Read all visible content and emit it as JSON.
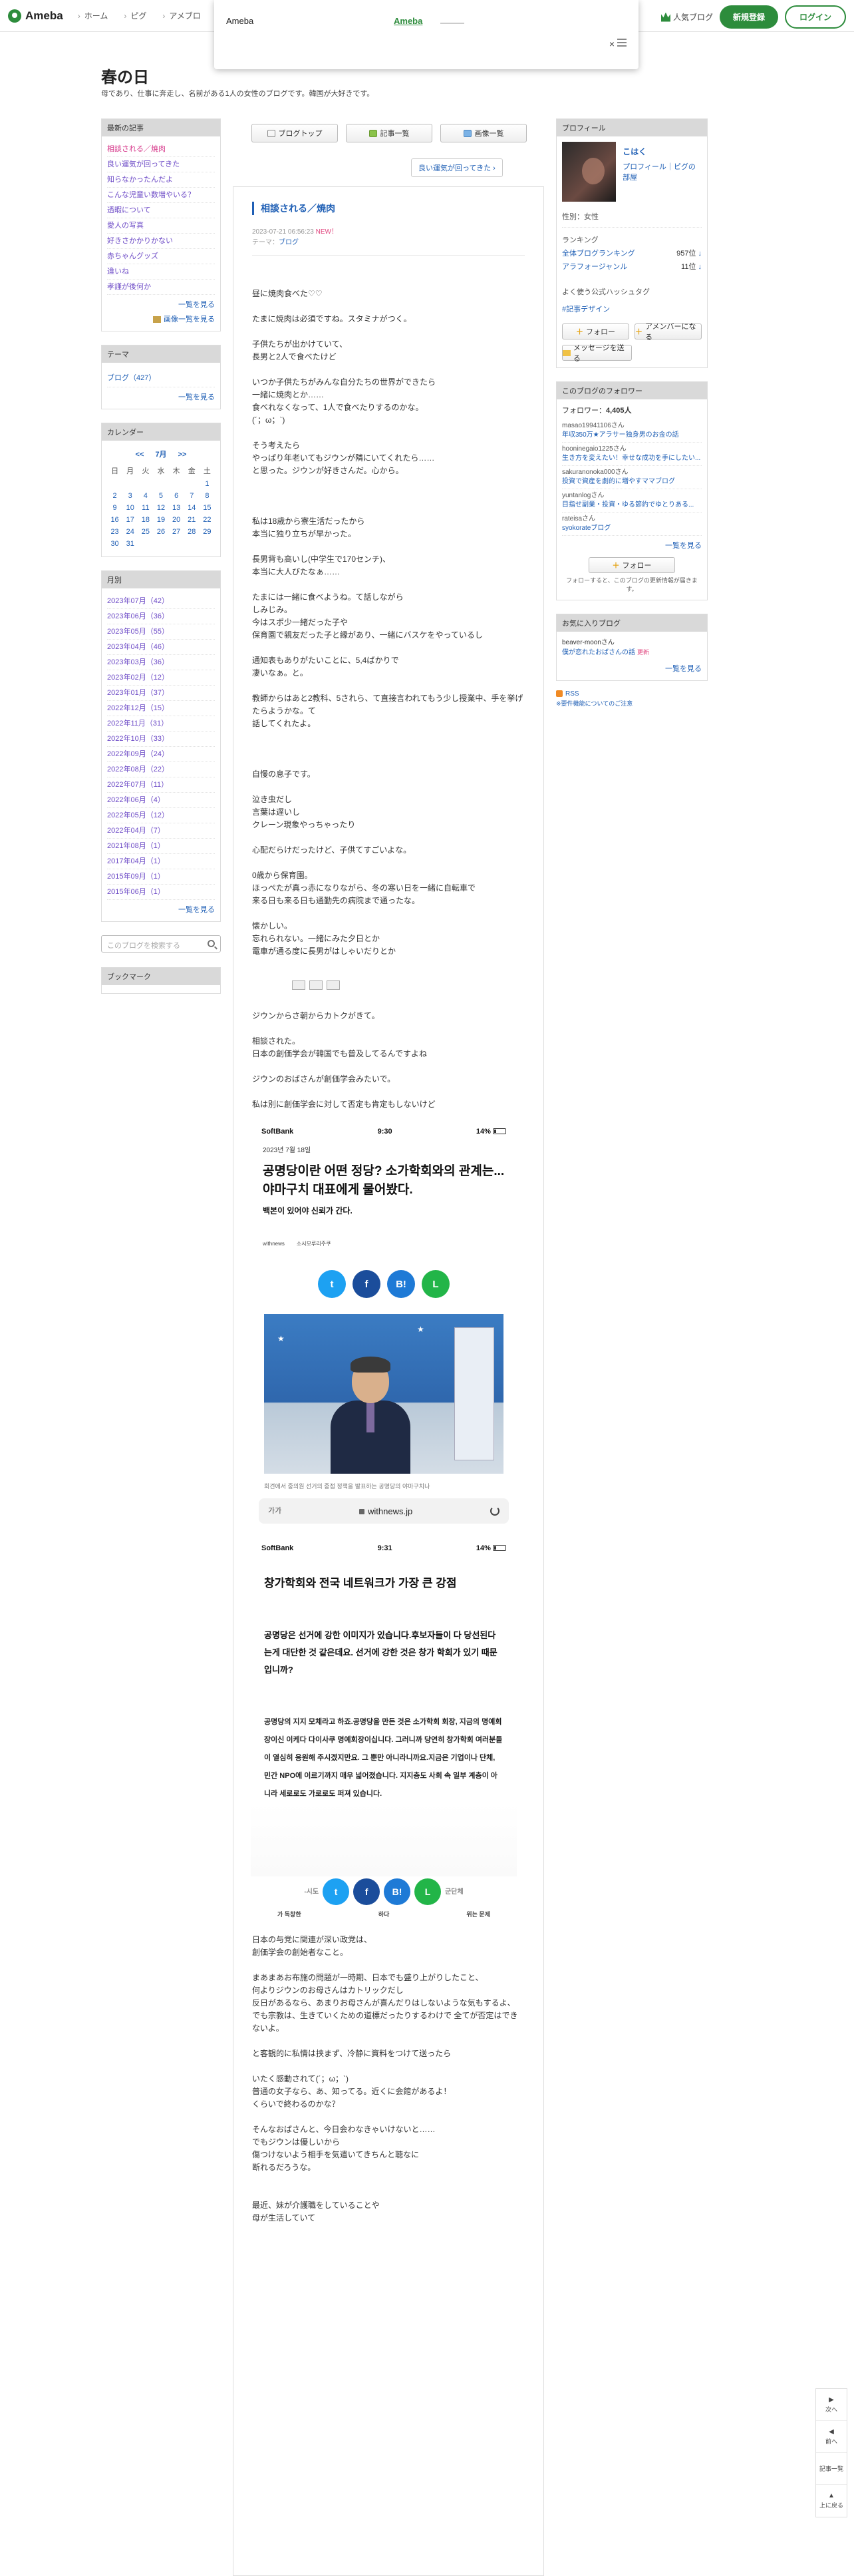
{
  "global_header": {
    "logo": "Ameba",
    "nav": [
      "ホーム",
      "ピグ",
      "アメブロ"
    ],
    "popular_blog": "人気ブログ",
    "register": "新規登録",
    "login": "ログイン"
  },
  "popup": {
    "title": "Ameba",
    "link": "Ameba",
    "close": "×"
  },
  "blog": {
    "title": "春の日",
    "description": "母であり、仕事に奔走し、名前がある1人の女性のブログです。韓国が大好きです。"
  },
  "sidebar_left": {
    "recent_header": "最新の記事",
    "recent": [
      "相談される／焼肉",
      "良い運気が回ってきた",
      "知らなかったんだよ",
      "こんな児童い数増やいる？",
      "透暇について",
      "愛人の写真",
      "好きさかかりかない",
      "赤ちゃんグッズ",
      "違いね",
      "孝謹が後何か"
    ],
    "recent_more": "一覧を見る",
    "recent_photo_more": "画像一覧を見る",
    "theme_header": "テーマ",
    "themes": [
      "ブログ（427）"
    ],
    "theme_more": "一覧を見る",
    "calendar_header": "カレンダー",
    "calendar": {
      "prev": "<<",
      "month": "7月",
      "next": ">>",
      "weekdays": [
        "日",
        "月",
        "火",
        "水",
        "木",
        "金",
        "土"
      ],
      "weeks": [
        [
          "",
          "",
          "",
          "",
          "",
          "",
          "1"
        ],
        [
          "2",
          "3",
          "4",
          "5",
          "6",
          "7",
          "8"
        ],
        [
          "9",
          "10",
          "11",
          "12",
          "13",
          "14",
          "15"
        ],
        [
          "16",
          "17",
          "18",
          "19",
          "20",
          "21",
          "22"
        ],
        [
          "23",
          "24",
          "25",
          "26",
          "27",
          "28",
          "29"
        ],
        [
          "30",
          "31",
          "",
          "",
          "",
          "",
          ""
        ]
      ]
    },
    "monthly_header": "月別",
    "months": [
      "2023年07月（42）",
      "2023年06月（36）",
      "2023年05月（55）",
      "2023年04月（46）",
      "2023年03月（36）",
      "2023年02月（12）",
      "2023年01月（37）",
      "2022年12月（15）",
      "2022年11月（31）",
      "2022年10月（33）",
      "2022年09月（24）",
      "2022年08月（22）",
      "2022年07月（11）",
      "2022年06月（4）",
      "2022年05月（12）",
      "2022年04月（7）",
      "2021年08月（1）",
      "2017年04月（1）",
      "2015年09月（1）",
      "2015年06月（1）"
    ],
    "months_more": "一覧を見る",
    "search_placeholder": "このブログを検索する",
    "bookmark_header": "ブックマーク"
  },
  "center": {
    "tabs": [
      "ブログトップ",
      "記事一覧",
      "画像一覧"
    ],
    "older_link": "良い運気が回ってきた",
    "article": {
      "title": "相談される／焼肉",
      "date": "2023-07-21 06:56:23",
      "new_badge": "NEW！",
      "theme_label": "テーマ：",
      "theme": "ブログ",
      "body_a": [
        "昼に焼肉食べた♡♡",
        "",
        "たまに焼肉は必須ですね。スタミナがつく。",
        "",
        "子供たちが出かけていて、",
        "長男と2人で食べたけど",
        "",
        "いつか子供たちがみんな自分たちの世界ができたら",
        "一緒に焼肉とか……",
        "食べれなくなって、1人で食べたりするのかな。",
        "(´；ω；`)",
        "",
        "そう考えたら",
        "やっぱり年老いてもジウンが隣にいてくれたら……",
        "と思った。ジウンが好きさんだ。心から。"
      ],
      "body_b": [
        "私は18歳から寮生活だったから",
        "本当に独り立ちが早かった。",
        "",
        "長男背も高いし(中学生で170センチ)、",
        "本当に大人びたなぁ……",
        "",
        "たまには一緒に食べようね。て話しながら",
        "しみじみ。",
        "今はスポ少一緒だった子や",
        "保育園で親友だった子と縁があり、一緒にバスケをやっているし",
        "",
        "通知表もありがたいことに、5,4ばかりで",
        "凄いなぁ。と。",
        "",
        "教師からはあと2教科、5されら、て直接言われてもう少し授業中、手を挙げたらようかな。て",
        "話してくれたよ。"
      ],
      "body_c": [
        "自慢の息子です。",
        "",
        "泣き虫だし",
        "言葉は遅いし",
        "クレーン現象やっちゃったり",
        "",
        "心配だらけだったけど、子供てすごいよな。",
        "",
        "0歳から保育園。",
        "ほっぺたが真っ赤になりながら、冬の寒い日を一緒に自転車で",
        "来る日も来る日も通勤先の病院まで通ったな。",
        "",
        "懐かしい。",
        "忘れられない。一緒にみた夕日とか",
        "電車が通る度に長男がはしゃいだりとか"
      ],
      "body_d": [
        "ジウンからさ朝からカトクがきて。",
        "",
        "相談された。",
        "日本の創価学会が韓国でも普及してるんですよね",
        "",
        "ジウンのおばさんが創価学会みたいで。",
        "",
        "私は別に創価学会に対して否定も肯定もしないけど"
      ],
      "body_e": [
        "日本の与党に関連が深い政党は、",
        "創価学会の創始者なこと。",
        "",
        "まあまあお布施の問題が一時期、日本でも盛り上がりしたこと、",
        "何よりジウンのお母さんはカトリックだし",
        "反日があるなら、あまりお母さんが喜んだりはしないような気もするよ、",
        "でも宗教は、生きていくための道標だったりするわけで 全てが否定はできないよ。",
        "",
        "と客観的に私情は挟まず、冷静に資料をつけて送ったら",
        "",
        "いたく感動されて(´；ω；`)",
        "普通の女子なら、あ、知ってる。近くに会館があるよ！",
        "くらいで終わるのかな？",
        "",
        "そんなおばさんと、今日会わなきゃいけないと……",
        "でもジウンは優しいから",
        "傷つけないよう相手を気遣いてきちんと聴なに",
        "断れるだろうな。",
        "",
        "",
        "最近、妹が介護職をしていることや",
        "母が生活していて"
      ]
    },
    "shot1": {
      "carrier": "SoftBank",
      "time": "9:30",
      "battery": "14%",
      "date": "2023년 7월 18일",
      "headline": "공명당이란 어떤 정당? 소가학회와의 관계는... 야마구치 대표에게 물어봤다.",
      "sub": "백본이 있어야 신뢰가 간다.",
      "source_a": "withnews",
      "source_b": "소시모루리주쿠",
      "caption": "회견에서 중의원 선거의 중점 정책을 발표하는 공명당의 야마구치나",
      "url_aa": "가가",
      "url": "withnews.jp"
    },
    "shot2": {
      "carrier": "SoftBank",
      "time": "9:31",
      "battery": "14%",
      "headline": "창가학회와 전국 네트워크가 가장 큰 강점",
      "lead": "공명당은 선거에 강한 이미지가 있습니다.후보자들이 다 당선된다는게 대단한 것 같은데요. 선거에 강한 것은 창가 학회가 있기 때문입니까?",
      "body": "공명당의 지지 모체라고 하죠.공명당을 만든 것은 소가학회 회장, 지금의 명예회장이신 이케다 다이사쿠 명예회장이십니다. 그러니까 당연히 창가학회 여러분들이 열심히 응원해 주시겠지만요. 그 뿐만 아니라니까요.지금은 기업이나 단체, 민간 NPO에 이르기까지 매우 넓어졌습니다. 지지층도 사회 속 일부 계층이 아니라 세로로도 가로로도 퍼져 있습니다.",
      "share_left": "-시도",
      "share_right": "군단체",
      "foot_left": "가 독창한",
      "foot_mid": "하다",
      "foot_right": "위는 문제"
    }
  },
  "sidebar_right": {
    "profile_header": "プロフィール",
    "name": "こはく",
    "profile_links": "プロフィール｜ピグの部屋",
    "sex": "性別：女性",
    "ranking_header": "ランキング",
    "ranking": [
      {
        "label": "全体ブログランキング",
        "value": "957位"
      },
      {
        "label": "アラフォージャンル",
        "value": "11位"
      }
    ],
    "hashtag_header": "よく使う公式ハッシュタグ",
    "hashtag": "#記事デザイン",
    "follow_btn": "フォロー",
    "amember_btn": "アメンバーになる",
    "message_btn": "メッセージを送る",
    "following_header": "このブログのフォロワー",
    "follower_count_label": "フォロワー：",
    "follower_count": "4,405人",
    "followers": [
      {
        "user": "masao19941106さん",
        "blog": "年収350万★アラサー独身男のお金の話"
      },
      {
        "user": "hooninegaio1225さん",
        "blog": "生き方を変えたい！幸せな成功を手にしたい..."
      },
      {
        "user": "sakuranonoka000さん",
        "blog": "投資で資産を劇的に増やすママブログ"
      },
      {
        "user": "yuntanlogさん",
        "blog": "目指せ副業・投資・ゆる節約でゆとりある..."
      },
      {
        "user": "rateisaさん",
        "blog": "syokorateブログ"
      }
    ],
    "followers_more": "一覧を見る",
    "follow_note": "フォローすると、このブログの更新情報が届きます。",
    "favorites_header": "お気に入りブログ",
    "favorites": [
      {
        "user": "beaver-moonさん",
        "blog": "僕が恋れたおばさんの話",
        "updated": "更新"
      }
    ],
    "favorites_more": "一覧を見る",
    "rss": "RSS",
    "rss_note": "※要件機能についてのご注意"
  },
  "float_widget": {
    "next": "次へ",
    "prev": "前へ",
    "list": "記事一覧",
    "top": "上に戻る"
  }
}
